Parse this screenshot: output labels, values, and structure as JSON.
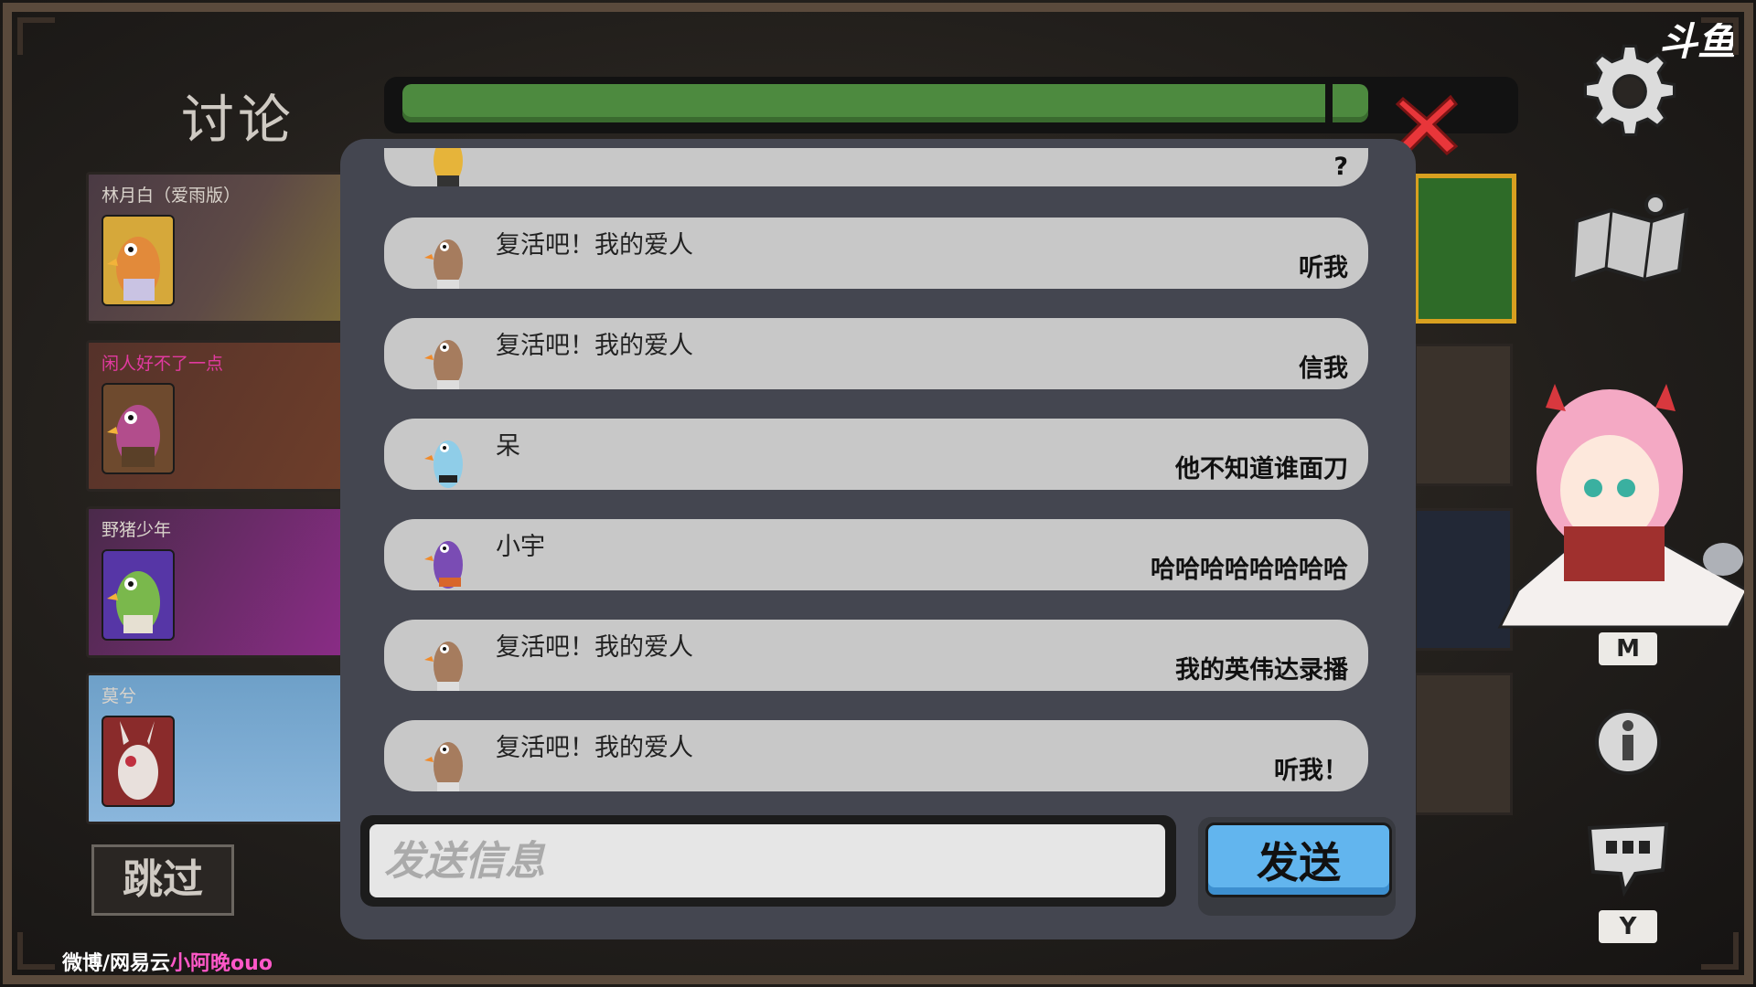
{
  "header": {
    "title": "讨论",
    "timer_progress": 0.88
  },
  "watermark": "斗鱼",
  "players": [
    {
      "name": "林月白（爱雨版）",
      "color": "#d9d3cb"
    },
    {
      "name": "闲人好不了一点",
      "color": "#e23aa0"
    },
    {
      "name": "野猪少年",
      "color": "#d9d3cb"
    },
    {
      "name": "莫兮",
      "color": "#d9d3cb"
    }
  ],
  "skip_label": "跳过",
  "messages": [
    {
      "sender": "",
      "text": "?",
      "avatar": "goose-yellow"
    },
    {
      "sender": "复活吧！我的爱人",
      "text": "听我",
      "avatar": "goose-brown"
    },
    {
      "sender": "复活吧！我的爱人",
      "text": "信我",
      "avatar": "goose-brown"
    },
    {
      "sender": "呆",
      "text": "他不知道谁面刀",
      "avatar": "goose-blue"
    },
    {
      "sender": "小宇",
      "text": "哈哈哈哈哈哈哈哈",
      "avatar": "goose-purple"
    },
    {
      "sender": "复活吧！我的爱人",
      "text": "我的英伟达录播",
      "avatar": "goose-brown"
    },
    {
      "sender": "复活吧！我的爱人",
      "text": "听我！",
      "avatar": "goose-brown"
    }
  ],
  "input": {
    "placeholder": "发送信息",
    "value": ""
  },
  "send_label": "发送",
  "hotkeys": {
    "map": "M",
    "chat": "Y"
  },
  "footer": {
    "prefix": "微博/网易云",
    "highlight": "小阿晚ouo"
  },
  "icons": [
    "gear-icon",
    "map-icon",
    "info-icon",
    "chat-icon",
    "close-icon"
  ]
}
